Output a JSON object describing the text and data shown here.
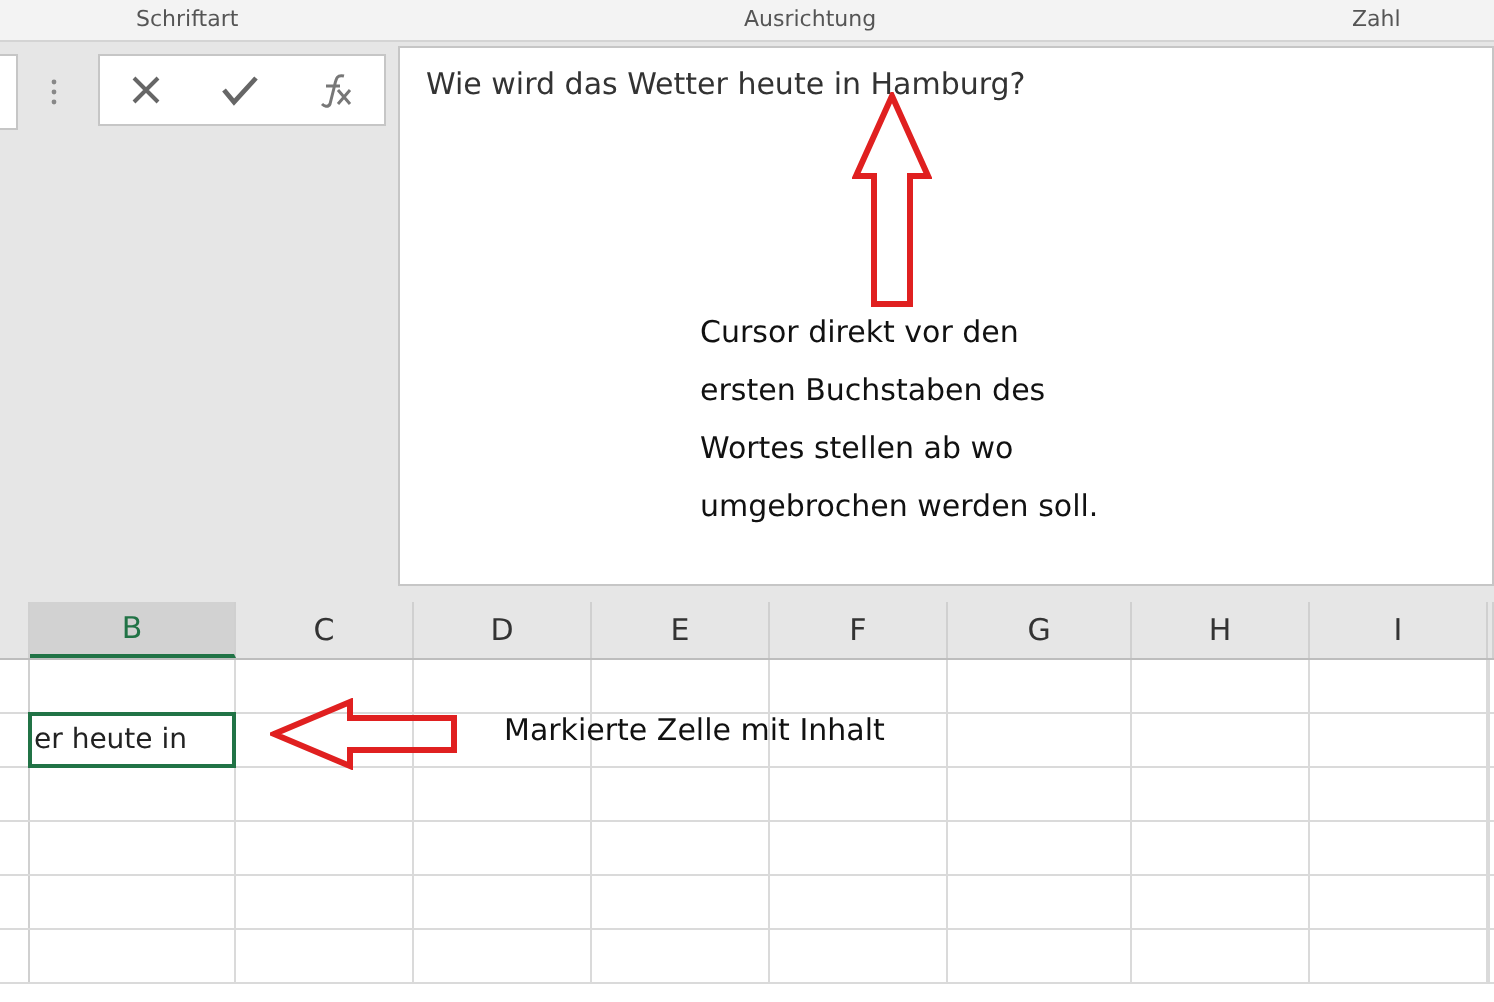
{
  "ribbon": {
    "groups": [
      {
        "label": "Schriftart"
      },
      {
        "label": "Ausrichtung"
      },
      {
        "label": "Zahl"
      }
    ]
  },
  "formula_bar": {
    "value": "Wie wird das Wetter heute in Hamburg?"
  },
  "annotations": [
    {
      "kind": "up-arrow",
      "text": "Cursor direkt vor den\nersten Buchstaben des\nWortes stellen ab wo\numgebrochen werden soll."
    },
    {
      "kind": "left-arrow",
      "text": "Markierte Zelle mit Inhalt"
    }
  ],
  "grid": {
    "columns": [
      {
        "label": "B",
        "selected": true
      },
      {
        "label": "C",
        "selected": false
      },
      {
        "label": "D",
        "selected": false
      },
      {
        "label": "E",
        "selected": false
      },
      {
        "label": "F",
        "selected": false
      },
      {
        "label": "G",
        "selected": false
      },
      {
        "label": "H",
        "selected": false
      },
      {
        "label": "I",
        "selected": false
      }
    ],
    "active_cell": {
      "value": "er heute in"
    }
  }
}
